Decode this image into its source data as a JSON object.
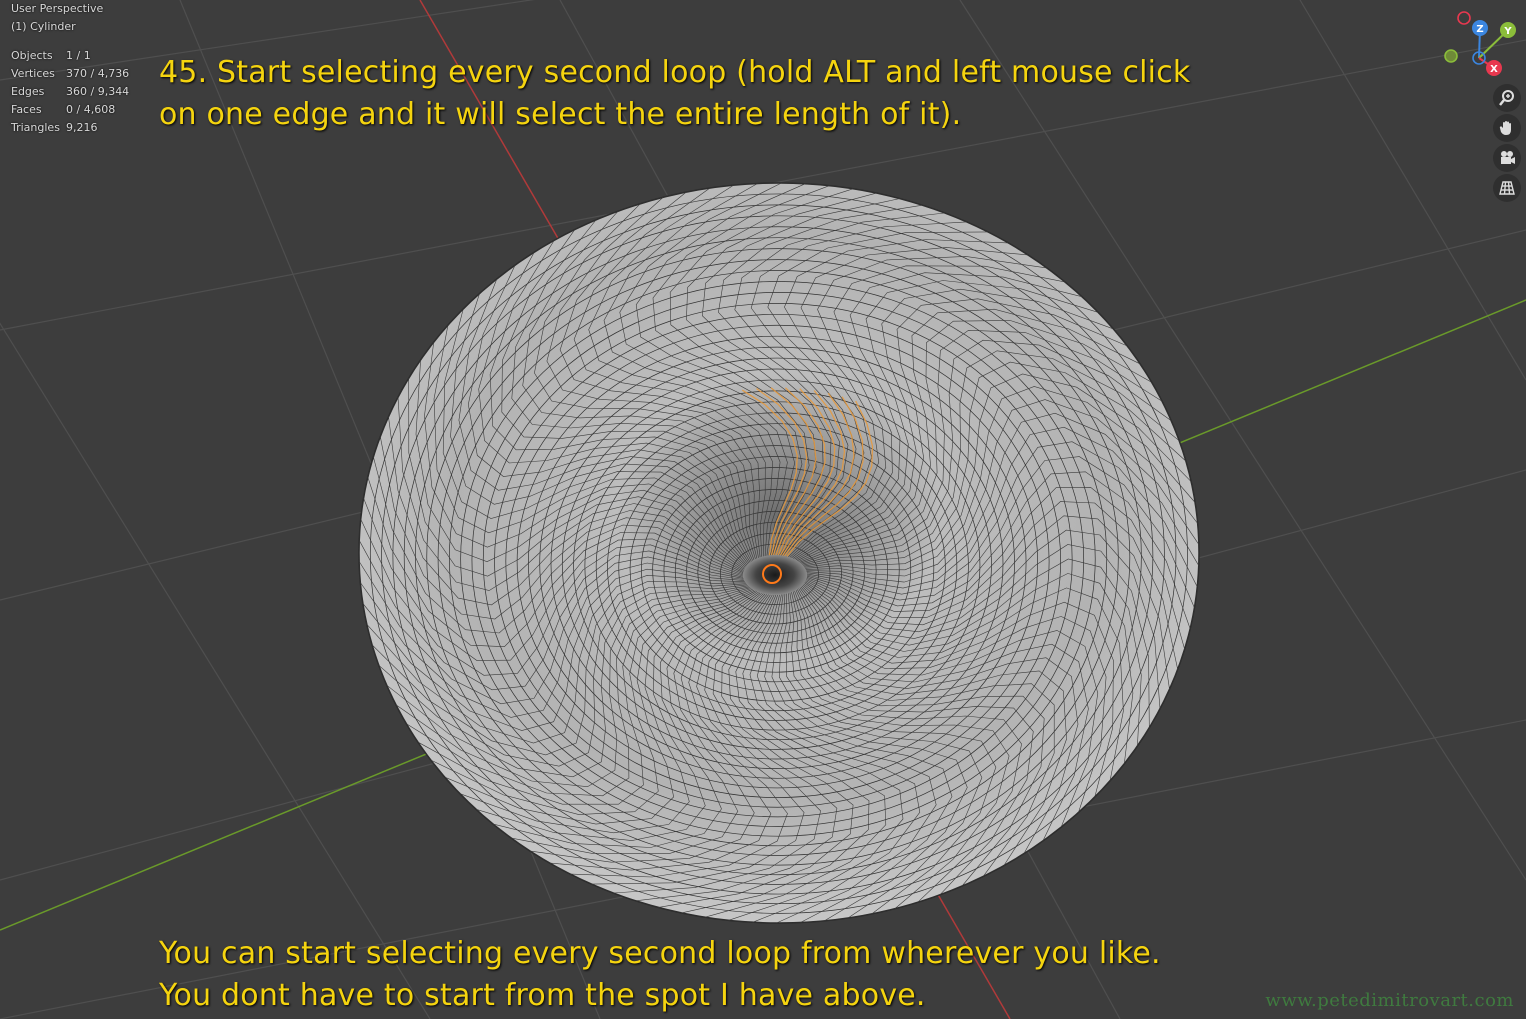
{
  "viewport": {
    "view_name": "User Perspective",
    "object_name": "(1) Cylinder"
  },
  "stats": [
    {
      "label": "Objects",
      "value": "1 / 1"
    },
    {
      "label": "Vertices",
      "value": "370 / 4,736"
    },
    {
      "label": "Edges",
      "value": "360 / 9,344"
    },
    {
      "label": "Faces",
      "value": "0 / 4,608"
    },
    {
      "label": "Triangles",
      "value": "9,216"
    }
  ],
  "captions": {
    "top_line1": "45. Start selecting every second loop (hold ALT and left mouse click",
    "top_line2": "on one edge and it will select the entire length of it).",
    "bottom_line1": "You can start selecting every second loop from wherever you like.",
    "bottom_line2": "You dont have to start from the spot I have above."
  },
  "watermark": "www.petedimitrovart.com",
  "gizmo": {
    "axes": [
      "Z",
      "Y",
      "X"
    ],
    "colors": {
      "x": "#e8384f",
      "y": "#8bbd3a",
      "z": "#3b86e0"
    }
  },
  "nav_icons": [
    "zoom-icon",
    "hand-icon",
    "camera-icon",
    "grid-icon"
  ],
  "colors": {
    "background": "#3d3d3d",
    "grid": "#4d4d4d",
    "caption": "#f5d40f",
    "selection": "#e89a3c",
    "mesh": "#b9b9b9"
  }
}
